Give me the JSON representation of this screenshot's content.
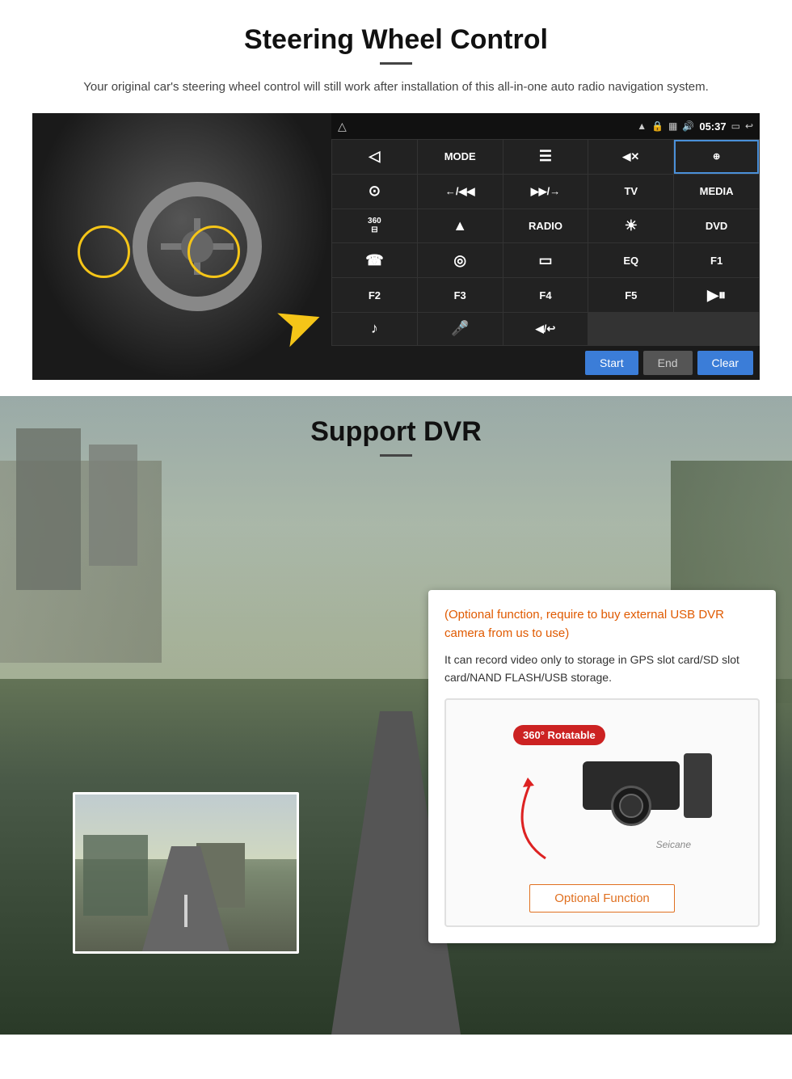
{
  "steering": {
    "title": "Steering Wheel Control",
    "subtitle": "Your original car's steering wheel control will still work after installation of this all-in-one auto radio navigation system.",
    "statusbar": {
      "time": "05:37",
      "icons": [
        "wifi",
        "lock",
        "sim",
        "volume"
      ]
    },
    "buttons": [
      {
        "label": "◁",
        "type": "icon"
      },
      {
        "label": "MODE",
        "type": "text"
      },
      {
        "label": "☰",
        "type": "icon"
      },
      {
        "label": "◀✕",
        "type": "icon"
      },
      {
        "label": "⊕",
        "type": "icon"
      },
      {
        "label": "⊙",
        "type": "icon"
      },
      {
        "label": "←/◀◀",
        "type": "text"
      },
      {
        "label": "▶▶/→",
        "type": "text"
      },
      {
        "label": "TV",
        "type": "text"
      },
      {
        "label": "MEDIA",
        "type": "text"
      },
      {
        "label": "360",
        "type": "text",
        "small": true
      },
      {
        "label": "▲",
        "type": "icon"
      },
      {
        "label": "RADIO",
        "type": "text"
      },
      {
        "label": "☀",
        "type": "icon"
      },
      {
        "label": "DVD",
        "type": "text"
      },
      {
        "label": "☎",
        "type": "icon"
      },
      {
        "label": "◎",
        "type": "icon"
      },
      {
        "label": "▭",
        "type": "icon"
      },
      {
        "label": "EQ",
        "type": "text"
      },
      {
        "label": "F1",
        "type": "text"
      },
      {
        "label": "F2",
        "type": "text"
      },
      {
        "label": "F3",
        "type": "text"
      },
      {
        "label": "F4",
        "type": "text"
      },
      {
        "label": "F5",
        "type": "text"
      },
      {
        "label": "▶⏸",
        "type": "icon"
      },
      {
        "label": "♪",
        "type": "icon"
      },
      {
        "label": "🎤",
        "type": "icon"
      },
      {
        "label": "◀/↩",
        "type": "icon"
      }
    ],
    "bottom_bar": {
      "start_label": "Start",
      "end_label": "End",
      "clear_label": "Clear"
    }
  },
  "dvr": {
    "title": "Support DVR",
    "optional_text": "(Optional function, require to buy external USB DVR camera from us to use)",
    "desc_text": "It can record video only to storage in GPS slot card/SD slot card/NAND FLASH/USB storage.",
    "badge_360": "360° Rotatable",
    "watermark": "Seicane",
    "optional_function_label": "Optional Function"
  }
}
